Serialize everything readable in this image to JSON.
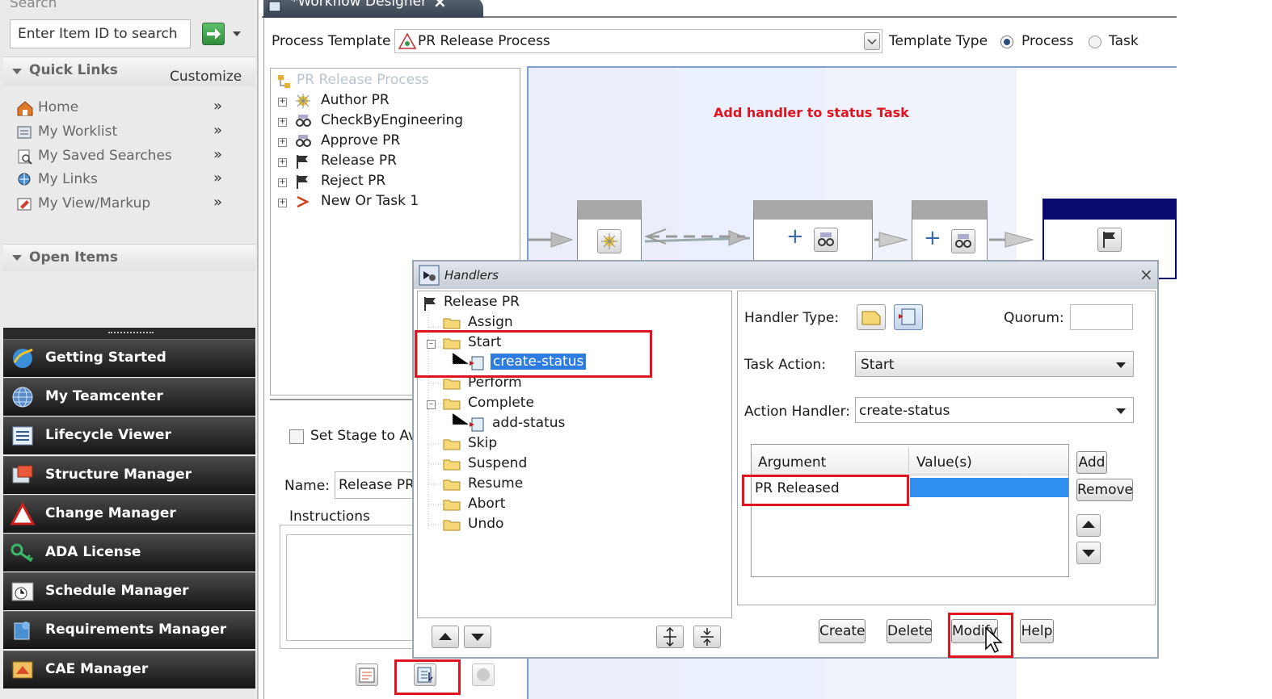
{
  "left_panel": {
    "search_header": "Search",
    "search_placeholder": "Enter Item ID to search",
    "quick_links_title": "Quick Links",
    "customize_label": "Customize",
    "quick_links": [
      {
        "label": "Home",
        "icon": "home-icon"
      },
      {
        "label": "My Worklist",
        "icon": "worklist-icon"
      },
      {
        "label": "My Saved Searches",
        "icon": "saved-search-icon"
      },
      {
        "label": "My Links",
        "icon": "links-icon"
      },
      {
        "label": "My View/Markup",
        "icon": "markup-icon"
      }
    ],
    "open_items_title": "Open Items",
    "nav_items": [
      {
        "label": "Getting Started",
        "icon": "getting-started-icon"
      },
      {
        "label": "My Teamcenter",
        "icon": "globe-icon"
      },
      {
        "label": "Lifecycle Viewer",
        "icon": "viewer-icon"
      },
      {
        "label": "Structure Manager",
        "icon": "structure-icon"
      },
      {
        "label": "Change Manager",
        "icon": "change-icon"
      },
      {
        "label": "ADA License",
        "icon": "key-icon"
      },
      {
        "label": "Schedule Manager",
        "icon": "schedule-icon"
      },
      {
        "label": "Requirements Manager",
        "icon": "requirements-icon"
      },
      {
        "label": "CAE Manager",
        "icon": "cae-icon"
      }
    ]
  },
  "designer": {
    "tab_title": "*Workflow Designer",
    "process_template_label": "Process Template",
    "process_template_value": "PR Release Process",
    "template_type_label": "Template Type",
    "type_process": "Process",
    "type_task": "Task",
    "tree_root": "PR Release Process",
    "tree_items": [
      "Author PR",
      "CheckByEngineering",
      "Approve PR",
      "Release PR",
      "Reject PR",
      "New Or Task 1"
    ],
    "set_stage_label": "Set Stage to Ava",
    "name_label": "Name:",
    "name_value": "Release PR",
    "instructions_label": "Instructions",
    "annotation": "Add handler to status Task",
    "annotation_color": "#e0141e"
  },
  "handlers_dialog": {
    "title": "Handlers",
    "tree_root": "Release PR",
    "tree": [
      {
        "label": "Assign",
        "level": 1
      },
      {
        "label": "Start",
        "level": 1
      },
      {
        "label": "create-status",
        "level": 2,
        "selected": true
      },
      {
        "label": "Perform",
        "level": 1
      },
      {
        "label": "Complete",
        "level": 1
      },
      {
        "label": "add-status",
        "level": 2
      },
      {
        "label": "Skip",
        "level": 1
      },
      {
        "label": "Suspend",
        "level": 1
      },
      {
        "label": "Resume",
        "level": 1
      },
      {
        "label": "Abort",
        "level": 1
      },
      {
        "label": "Undo",
        "level": 1
      }
    ],
    "handler_type_label": "Handler Type:",
    "quorum_label": "Quorum:",
    "task_action_label": "Task Action:",
    "task_action_value": "Start",
    "action_handler_label": "Action Handler:",
    "action_handler_value": "create-status",
    "col_argument": "Argument",
    "col_values": "Value(s)",
    "argument_row": "PR Released",
    "add_label": "Add",
    "remove_label": "Remove",
    "create_label": "Create",
    "delete_label": "Delete",
    "modify_label": "Modify",
    "help_label": "Help"
  }
}
